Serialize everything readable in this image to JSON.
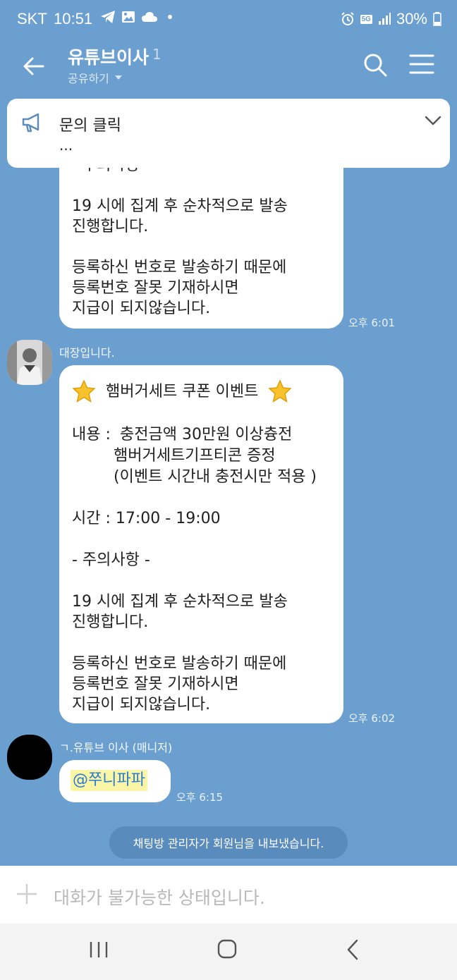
{
  "status_bar": {
    "carrier": "SKT",
    "time": "10:51",
    "network": "5G",
    "battery": "30%"
  },
  "header": {
    "title": "유튜브이사",
    "member_count": "1",
    "subtitle": "공유하기"
  },
  "notice": {
    "title": "문의 클릭",
    "preview": "..."
  },
  "messages": [
    {
      "lines": [
        "- 주의사항 -",
        "",
        "19 시에 집계 후 순차적으로 발송",
        "진행합니다.",
        "",
        "등록하신 번호로 발송하기 때문에",
        "등록번호 잘못 기재하시면",
        "지급이 되지않습니다."
      ],
      "time": "오후 6:01"
    },
    {
      "sender": "대장입니다.",
      "title": "햄버거세트 쿠폰 이벤트",
      "content_label": "내용 :",
      "content_lines": [
        "충전금액 30만원 이상츙전",
        "햄버거세트기프티콘 증정",
        "(이벤트 시간내 충전시만 적용 )"
      ],
      "time_line": "시간  : 17:00 - 19:00",
      "caution": "- 주의사항 -",
      "lines": [
        "19 시에 집계 후 순차적으로 발송",
        "진행합니다.",
        "",
        "등록하신 번호로 발송하기 때문에",
        "등록번호 잘못 기재하시면",
        "지급이 되지않습니다."
      ],
      "time": "오후 6:02"
    },
    {
      "sender": "ㄱ.유튜브 이사 (매니저)",
      "mention": "@쭈니파파",
      "time": "오후 6:15"
    }
  ],
  "system_message": "채팅방 관리자가 회원님을 내보냈습니다.",
  "input": {
    "placeholder": "대화가 불가능한 상태입니다."
  },
  "icons": {
    "back": "arrow-left-icon",
    "search": "search-icon",
    "menu": "hamburger-icon",
    "notice": "megaphone-icon",
    "star": "star-icon"
  }
}
